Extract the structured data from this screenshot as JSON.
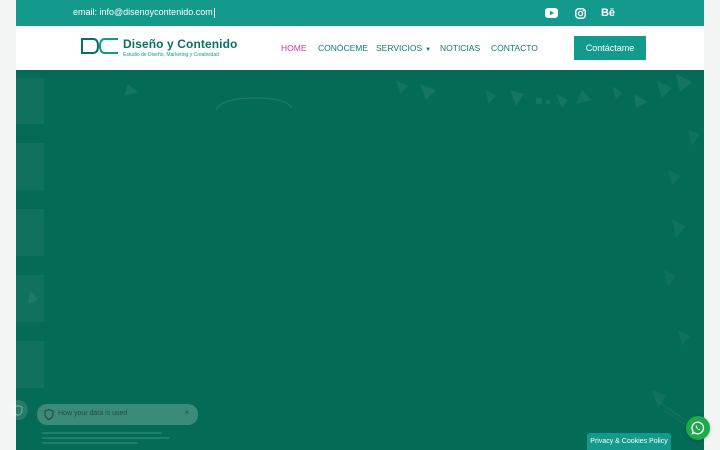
{
  "topbar": {
    "email": "email: info@disenoycontenido.com",
    "icons": [
      "youtube-icon",
      "instagram-icon",
      "behance-icon"
    ],
    "behance_label": "Bē"
  },
  "logo": {
    "title": "Diseño y Contenido",
    "subtitle": "Estudio de Diseño, Marketing y Creatividad"
  },
  "nav": {
    "items": [
      {
        "label": "HOME",
        "active": true
      },
      {
        "label": "CONÓCEME",
        "active": false
      },
      {
        "label": "SERVICIOS",
        "active": false,
        "has_dropdown": true
      },
      {
        "label": "NOTICIAS",
        "active": false
      },
      {
        "label": "CONTACTO",
        "active": false
      }
    ],
    "cta_label": "Contáctame"
  },
  "cookie": {
    "title": "How your data is used",
    "close": "×",
    "policy_button": "Privacy & Cookies Policy"
  },
  "colors": {
    "brand": "#149a8c",
    "hero": "#046b56",
    "active_nav": "#c8379a",
    "whatsapp": "#1ea94c"
  }
}
